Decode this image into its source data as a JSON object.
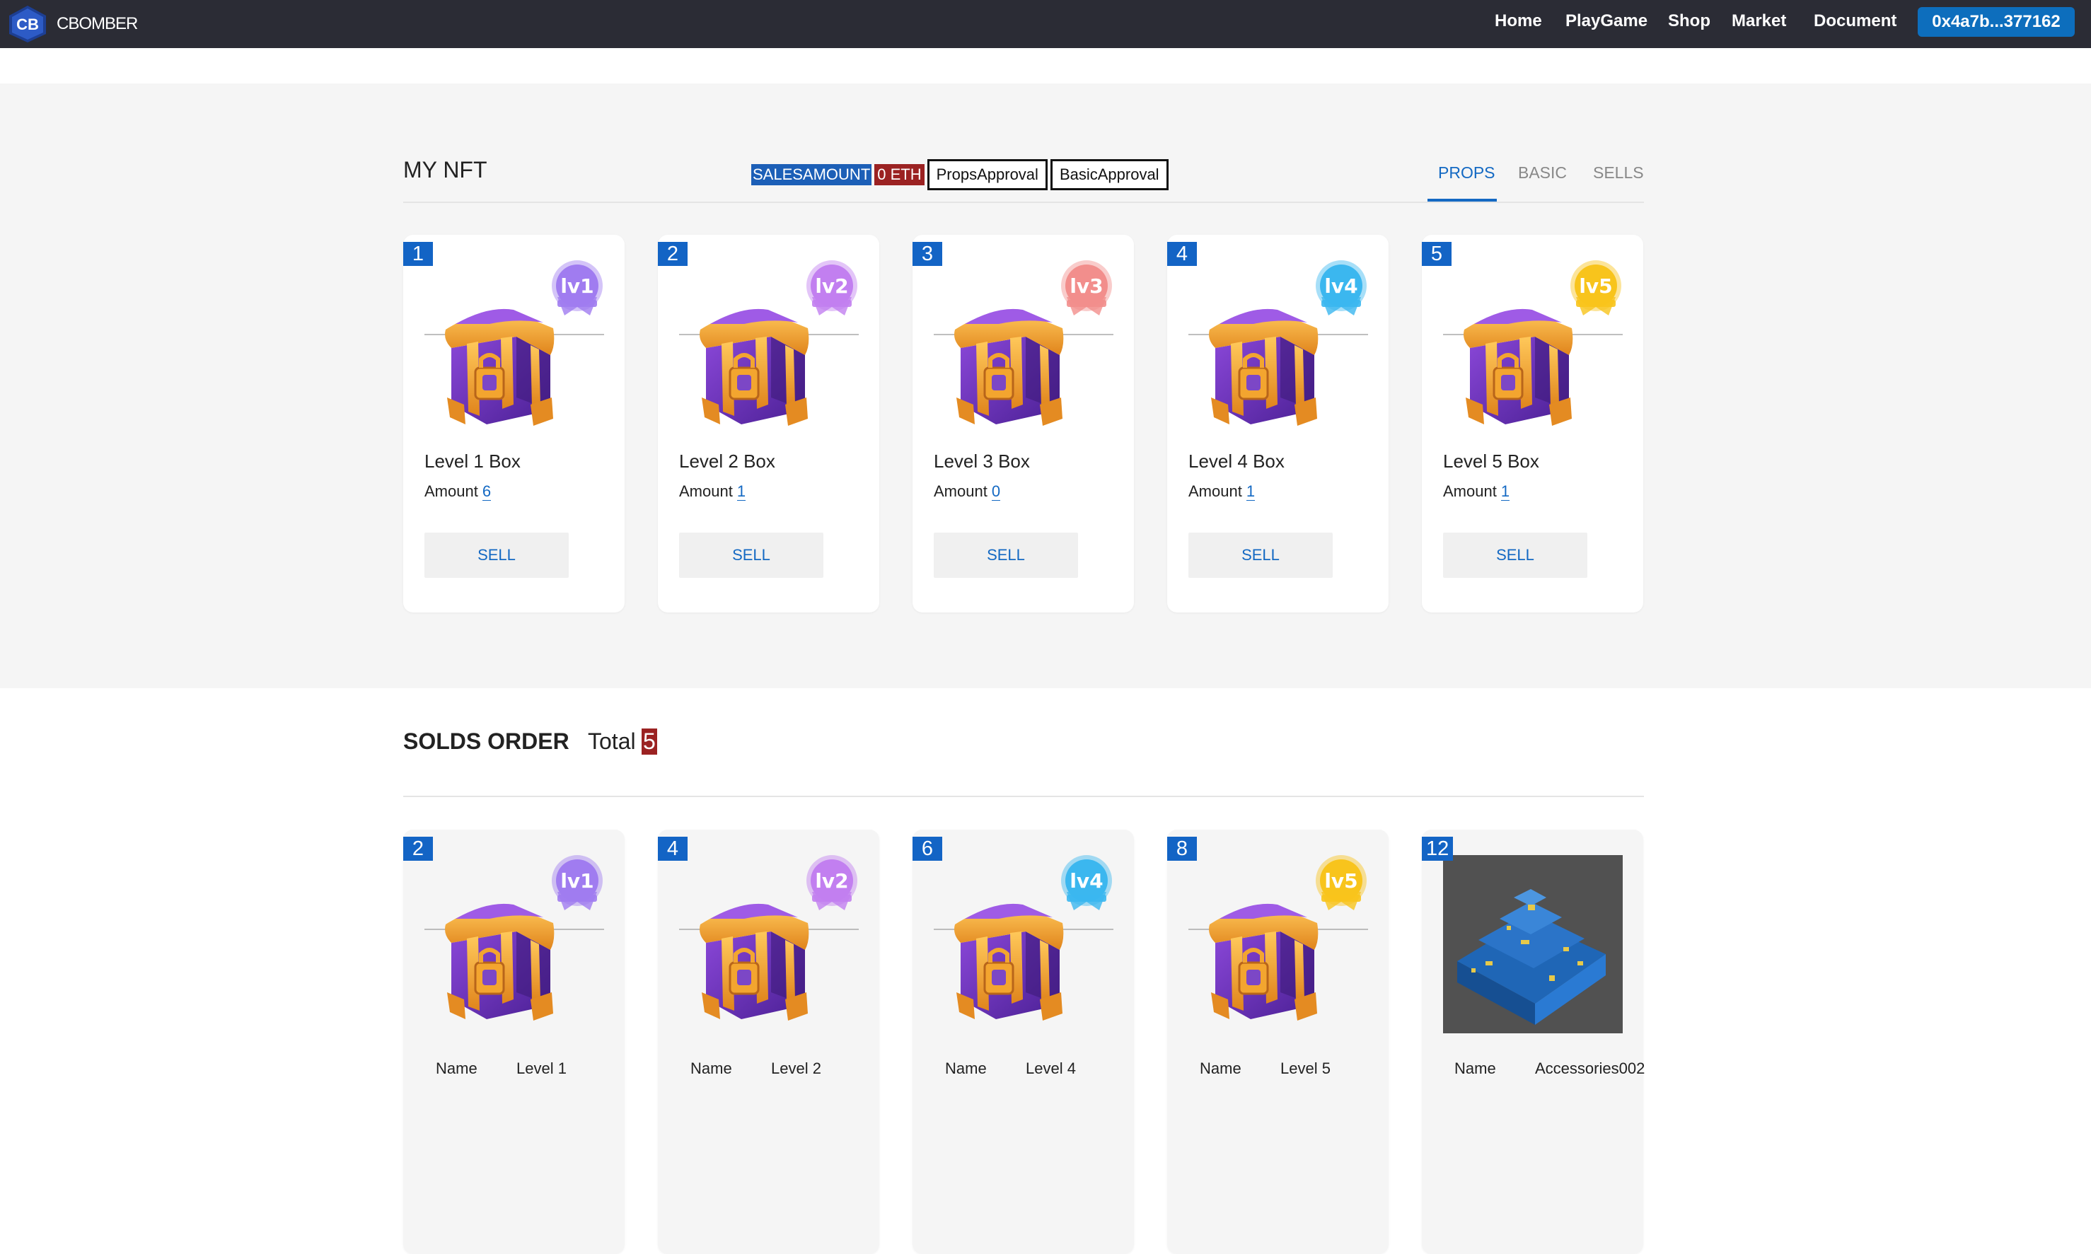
{
  "nav": {
    "brand": "CBOMBER",
    "links": [
      "Home",
      "PlayGame",
      "Shop",
      "Market",
      "Document"
    ],
    "wallet": "0x4a7b...377162"
  },
  "my_nft": {
    "title": "MY NFT",
    "sales_label": "SALESAMOUNT",
    "sales_value": "0 ETH",
    "props_approval": "PropsApproval",
    "basic_approval": "BasicApproval",
    "tabs": [
      "PROPS",
      "BASIC",
      "SELLS"
    ],
    "active_tab": "PROPS",
    "cards": [
      {
        "id": "1",
        "level": "lv1",
        "name": "Level 1 Box",
        "amount_label": "Amount",
        "amount": "6",
        "sell": "SELL"
      },
      {
        "id": "2",
        "level": "lv2",
        "name": "Level 2 Box",
        "amount_label": "Amount",
        "amount": "1",
        "sell": "SELL"
      },
      {
        "id": "3",
        "level": "lv3",
        "name": "Level 3 Box",
        "amount_label": "Amount",
        "amount": "0",
        "sell": "SELL"
      },
      {
        "id": "4",
        "level": "lv4",
        "name": "Level 4 Box",
        "amount_label": "Amount",
        "amount": "1",
        "sell": "SELL"
      },
      {
        "id": "5",
        "level": "lv5",
        "name": "Level 5 Box",
        "amount_label": "Amount",
        "amount": "1",
        "sell": "SELL"
      }
    ]
  },
  "solds": {
    "title": "SOLDS ORDER",
    "total_label": "Total",
    "total": "5",
    "cards": [
      {
        "id": "2",
        "level": "lv1",
        "name_label": "Name",
        "name": "Level 1"
      },
      {
        "id": "4",
        "level": "lv2",
        "name_label": "Name",
        "name": "Level 2"
      },
      {
        "id": "6",
        "level": "lv4",
        "name_label": "Name",
        "name": "Level 4"
      },
      {
        "id": "8",
        "level": "lv5",
        "name_label": "Name",
        "name": "Level 5"
      },
      {
        "id": "12",
        "level": "",
        "name_label": "Name",
        "name": "Accessories002"
      }
    ]
  },
  "colors": {
    "navbar": "#2b2c35",
    "accent_blue": "#1469c3",
    "badge_blue": "#1364c5",
    "red_value": "#9b2222",
    "lv1": "#a07cf0",
    "lv2": "#c27ff0",
    "lv3": "#f28e8c",
    "lv4": "#3bb7ef",
    "lv5": "#f8c41c"
  },
  "icons": [
    "cbomber-logo-icon",
    "level-badge-icon",
    "treasure-chest-icon",
    "blue-block-model-icon"
  ]
}
